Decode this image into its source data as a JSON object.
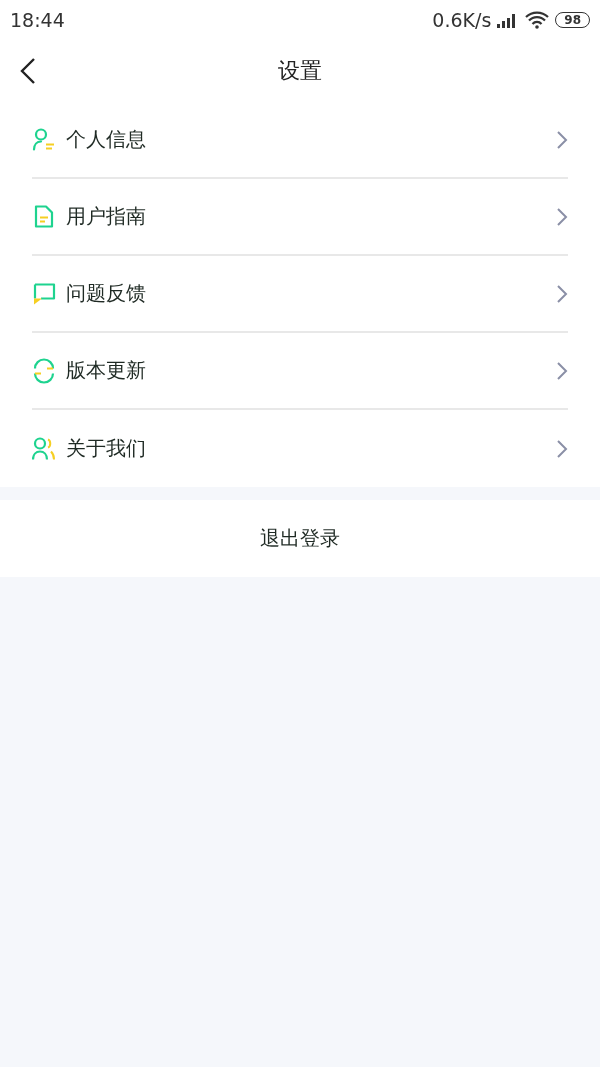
{
  "status_bar": {
    "time": "18:44",
    "speed": "0.6K/s",
    "battery": "98"
  },
  "header": {
    "title": "设置"
  },
  "menu": [
    {
      "label": "个人信息"
    },
    {
      "label": "用户指南"
    },
    {
      "label": "问题反馈"
    },
    {
      "label": "版本更新"
    },
    {
      "label": "关于我们"
    }
  ],
  "logout": "退出登录"
}
